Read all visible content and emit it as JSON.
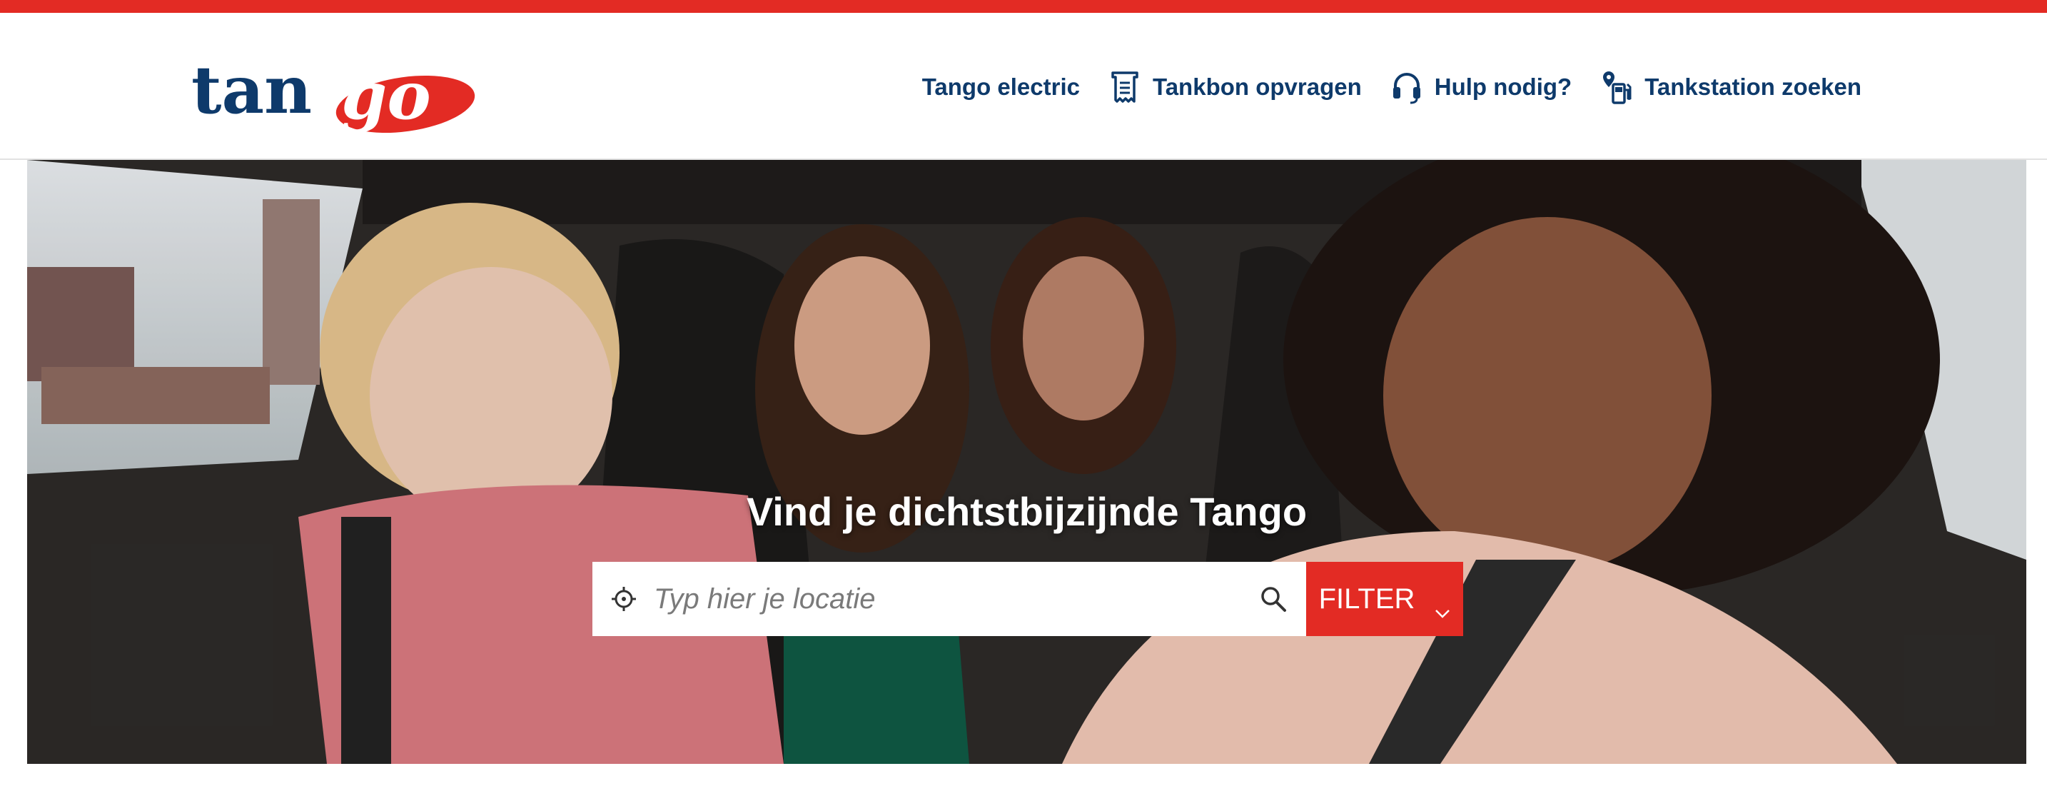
{
  "brand": {
    "logo_text_part1": "tan",
    "logo_text_part2": "go",
    "primary_color": "#0e3a6b",
    "accent_color": "#e32b24"
  },
  "nav": {
    "items": [
      {
        "label": "Tango electric",
        "icon": null
      },
      {
        "label": "Tankbon opvragen",
        "icon": "receipt-icon"
      },
      {
        "label": "Hulp nodig?",
        "icon": "headset-icon"
      },
      {
        "label": "Tankstation zoeken",
        "icon": "fuel-pump-icon"
      }
    ]
  },
  "hero": {
    "title": "Vind je dichtstbijzijnde Tango",
    "search": {
      "placeholder": "Typ hier je locatie",
      "value": ""
    },
    "filter_label": "FILTER"
  }
}
